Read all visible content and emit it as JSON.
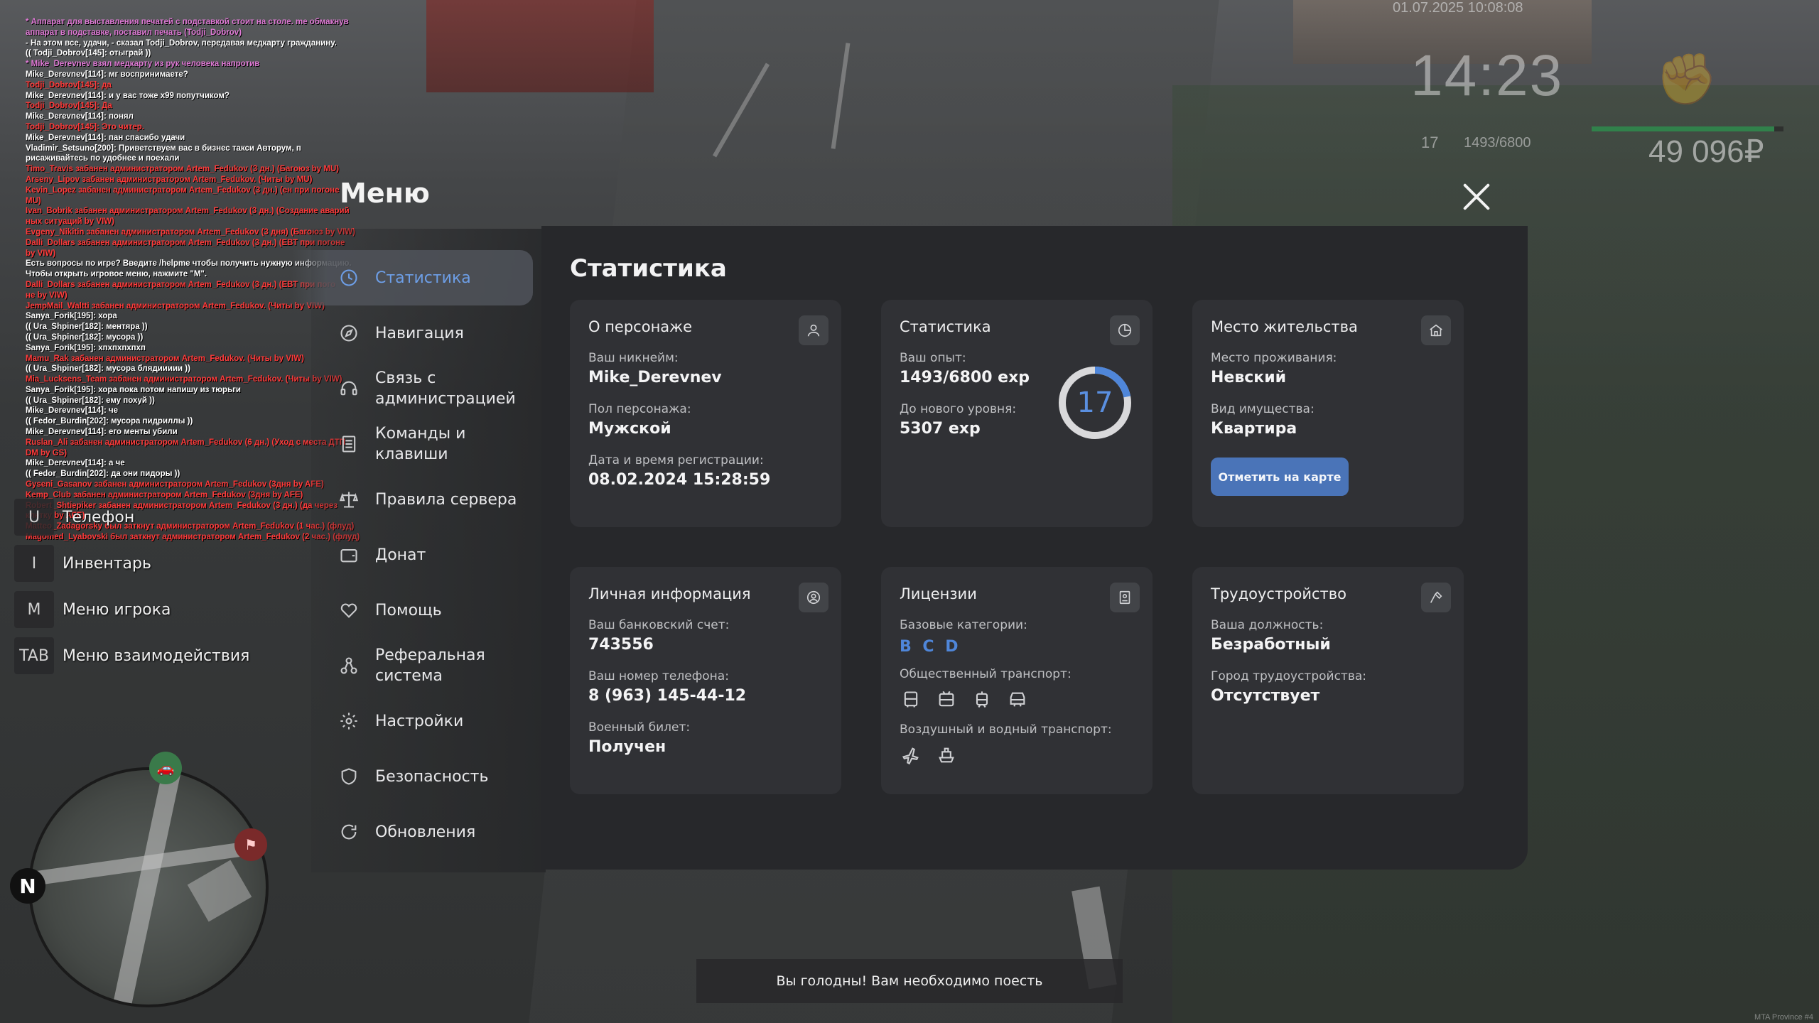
{
  "chat": [
    {
      "text": "* Аппарат для выставления печатей с подставкой стоит на столе. me обмакнув",
      "color": "pink"
    },
    {
      "text": "  аппарат в подставке, поставил печать (Todji_Dobrov)",
      "color": "pink"
    },
    {
      "text": "- На этом все, удачи, - сказал Todji_Dobrov, передавая медкарту гражданину.",
      "color": "white"
    },
    {
      "text": "(( Todji_Dobrov[145]: отыграй ))",
      "color": "white"
    },
    {
      "text": "* Mike_Derevnev взял медкарту из рук человека напротив",
      "color": "pink"
    },
    {
      "text": "Mike_Derevnev[114]: мг воспринимаете?",
      "color": "white"
    },
    {
      "text": "Todji_Dobrov[145]: да",
      "color": "red"
    },
    {
      "text": "Mike_Derevnev[114]: и у вас тоже х99 попутчиком?",
      "color": "white"
    },
    {
      "text": "Todji_Dobrov[145]: Да",
      "color": "red"
    },
    {
      "text": "Mike_Derevnev[114]: понял",
      "color": "white"
    },
    {
      "text": "Todji_Dobrov[145]: Это читер.",
      "color": "red"
    },
    {
      "text": "Mike_Derevnev[114]: пан спасибо удачи",
      "color": "white"
    },
    {
      "text": "Vladimir_Setsuno[200]: Приветствуем вас в бизнес такси Авторум, п",
      "color": "white"
    },
    {
      "text": "рисаживайтесь по удобнее и поехали",
      "color": "white"
    },
    {
      "text": "Timo_Travis забанен администратором Artem_Fedukov (3 дн.) (Багоюз by MU)",
      "color": "red"
    },
    {
      "text": "Arseny_Lipov забанен администратором Artem_Fedukov. (Читы by MU)",
      "color": "red"
    },
    {
      "text": "Kevin_Lopez забанен администратором Artem_Fedukov (3 дн.) (ен при погоне",
      "color": "red"
    },
    {
      "text": " MU)",
      "color": "red"
    },
    {
      "text": "Ivan_Bobrik забанен администратором Artem_Fedukov (3 дн.) (Создание аварий",
      "color": "red"
    },
    {
      "text": "ных ситуаций by VIW)",
      "color": "red"
    },
    {
      "text": "Evgeny_Nikitin забанен администратором Artem_Fedukov (3 дня) (Багоюз by VIW)",
      "color": "red"
    },
    {
      "text": "Dalli_Dollars забанен администратором Artem_Fedukov (3 дн.) (ЕВТ при погоне",
      "color": "red"
    },
    {
      "text": " by VIW)",
      "color": "red"
    },
    {
      "text": "Есть вопросы по игре? Введите /helpme чтобы получить нужную информацию.",
      "color": "white"
    },
    {
      "text": "Чтобы открыть игровое меню, нажмите \"M\".",
      "color": "white"
    },
    {
      "text": "Dalli_Dollars забанен администратором Artem_Fedukov (3 дн.) (ЕВТ при пого",
      "color": "red"
    },
    {
      "text": "не by VIW)",
      "color": "red"
    },
    {
      "text": "JempMail_Waltti забанен администратором Artem_Fedukov. (Читы by VIW)",
      "color": "red"
    },
    {
      "text": "Sanya_Forik[195]: хора",
      "color": "white"
    },
    {
      "text": "(( Ura_Shpiner[182]: ментяра ))",
      "color": "white"
    },
    {
      "text": "(( Ura_Shpiner[182]: мусора ))",
      "color": "white"
    },
    {
      "text": "Sanya_Forik[195]: хпхпхпхпхп",
      "color": "white"
    },
    {
      "text": "Mamu_Rak забанен администратором Artem_Fedukov. (Читы by VIW)",
      "color": "red"
    },
    {
      "text": "(( Ura_Shpiner[182]: мусора блядиииии ))",
      "color": "white"
    },
    {
      "text": "Mia_Lucksens_Team забанен администратором Artem_Fedukov. (Читы by VIW)",
      "color": "red"
    },
    {
      "text": "Sanya_Forik[195]: хора пока потом напишу из тюрьги",
      "color": "white"
    },
    {
      "text": "(( Ura_Shpiner[182]: ему похуй ))",
      "color": "white"
    },
    {
      "text": "Mike_Derevnev[114]: че",
      "color": "white"
    },
    {
      "text": "(( Fedor_Burdin[202]: мусора пидриллы ))",
      "color": "white"
    },
    {
      "text": "Mike_Derevnev[114]: его менты убили",
      "color": "white"
    },
    {
      "text": "Ruslan_Ali забанен администратором Artem_Fedukov (6 дн.) (Уход с места ДТП",
      "color": "red"
    },
    {
      "text": " DM by GS)",
      "color": "red"
    },
    {
      "text": "Mike_Derevnev[114]: а че",
      "color": "white"
    },
    {
      "text": "(( Fedor_Burdin[202]: да они пидоры ))",
      "color": "white"
    },
    {
      "text": "Gyseni_Gasanov забанен администратором Artem_Fedukov (3дня by AFE)",
      "color": "red"
    },
    {
      "text": "Kemp_Club забанен администратором Artem_Fedukov (3дня by AFE)",
      "color": "red"
    },
    {
      "text": "Robert_Shtiepiker забанен администратором Artem_Fedukov (3 дн.) (да через",
      "color": "red"
    },
    {
      "text": "клетку by AFE)",
      "color": "red"
    },
    {
      "text": "Matteo_Zadagorsky был заткнут администратором Artem_Fedukov (1 час.) (флуд)",
      "color": "red"
    },
    {
      "text": "Magomed_Lyabovski был заткнут администратором Artem_Fedukov (2 час.) (флуд)",
      "color": "red"
    }
  ],
  "hud": {
    "date": "01.07.2025 10:08:08",
    "time": "14:23",
    "level": "17",
    "exp": "1493/6800",
    "money": "49 096₽",
    "health_fraction": 0.95
  },
  "hotkeys": [
    {
      "key": "U",
      "label": "Телефон"
    },
    {
      "key": "I",
      "label": "Инвентарь"
    },
    {
      "key": "M",
      "label": "Меню игрока"
    },
    {
      "key": "TAB",
      "label": "Меню взаимодействия"
    }
  ],
  "minimap": {
    "north": "N"
  },
  "hunger_message": "Вы голодны! Вам необходимо поесть",
  "watermark": "MTA Province #4",
  "menu": {
    "title": "Меню",
    "nav": [
      {
        "label": "Статистика",
        "icon": "clock-icon",
        "active": true
      },
      {
        "label": "Навигация",
        "icon": "compass-icon",
        "active": false
      },
      {
        "label": "Связь с администрацией",
        "icon": "headset-icon",
        "active": false
      },
      {
        "label": "Команды и клавиши",
        "icon": "keyboard-icon",
        "active": false
      },
      {
        "label": "Правила сервера",
        "icon": "scales-icon",
        "active": false
      },
      {
        "label": "Донат",
        "icon": "wallet-icon",
        "active": false
      },
      {
        "label": "Помощь",
        "icon": "handshake-icon",
        "active": false
      },
      {
        "label": "Реферальная система",
        "icon": "network-icon",
        "active": false
      },
      {
        "label": "Настройки",
        "icon": "gear-icon",
        "active": false
      },
      {
        "label": "Безопасность",
        "icon": "shield-icon",
        "active": false
      },
      {
        "label": "Обновления",
        "icon": "refresh-icon",
        "active": false
      }
    ]
  },
  "stats": {
    "title": "Статистика",
    "character": {
      "title": "О персонаже",
      "nickname_label": "Ваш никнейм:",
      "nickname": "Mike_Derevnev",
      "gender_label": "Пол персонажа:",
      "gender": "Мужской",
      "reg_label": "Дата и время регистрации:",
      "reg_date": "08.02.2024 15:28:59"
    },
    "statistics": {
      "title": "Статистика",
      "exp_label": "Ваш опыт:",
      "exp": "1493/6800 exp",
      "next_label": "До нового уровня:",
      "next": "5307 exp",
      "level": "17",
      "progress": 0.2196
    },
    "residence": {
      "title": "Место жительства",
      "place_label": "Место проживания:",
      "place": "Невский",
      "type_label": "Вид имущества:",
      "type": "Квартира",
      "map_button": "Отметить на карте"
    },
    "personal": {
      "title": "Личная информация",
      "bank_label": "Ваш банковский счет:",
      "bank": "743556",
      "phone_label": "Ваш номер телефона:",
      "phone": "8 (963) 145-44-12",
      "military_label": "Военный билет:",
      "military": "Получен"
    },
    "licenses": {
      "title": "Лицензии",
      "base_label": "Базовые категории:",
      "base": "B C D",
      "public_label": "Общественный транспорт:",
      "public_icons": [
        "bus-icon",
        "trolleybus-icon",
        "tram-icon",
        "metro-icon"
      ],
      "air_label": "Воздушный и водный транспорт:",
      "air_icons": [
        "plane-icon",
        "ship-icon"
      ]
    },
    "employment": {
      "title": "Трудоустройство",
      "position_label": "Ваша должность:",
      "position": "Безработный",
      "city_label": "Город трудоустройства:",
      "city": "Отсутствует"
    }
  },
  "colors": {
    "accent": "#4a74b8",
    "active_nav": "#6d9ee6",
    "panel": "#27282b",
    "card": "#303135",
    "license_cats": "#4f86d9"
  }
}
